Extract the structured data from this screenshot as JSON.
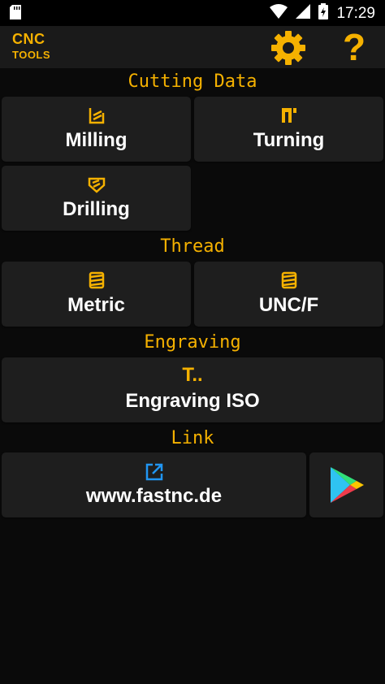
{
  "status_bar": {
    "time": "17:29"
  },
  "app_bar": {
    "logo_line1": "CNC",
    "logo_line2": "TOOLS",
    "help_glyph": "?"
  },
  "sections": {
    "cutting_data": "Cutting Data",
    "thread": "Thread",
    "engraving": "Engraving",
    "link": "Link"
  },
  "buttons": {
    "milling": "Milling",
    "turning": "Turning",
    "drilling": "Drilling",
    "metric": "Metric",
    "unc": "UNC/F",
    "engraving_iso": "Engraving ISO",
    "website": "www.fastnc.de"
  },
  "icons": {
    "engraving_glyph": "T..",
    "milling": "milling-icon",
    "turning": "turning-icon",
    "drilling": "drilling-icon",
    "thread": "thread-icon",
    "external_link": "external-link-icon",
    "play_store": "play-store-icon"
  },
  "colors": {
    "accent": "#f5b100",
    "background": "#0a0a0a",
    "tile": "#1e1e1e",
    "link_icon": "#2196f3"
  }
}
